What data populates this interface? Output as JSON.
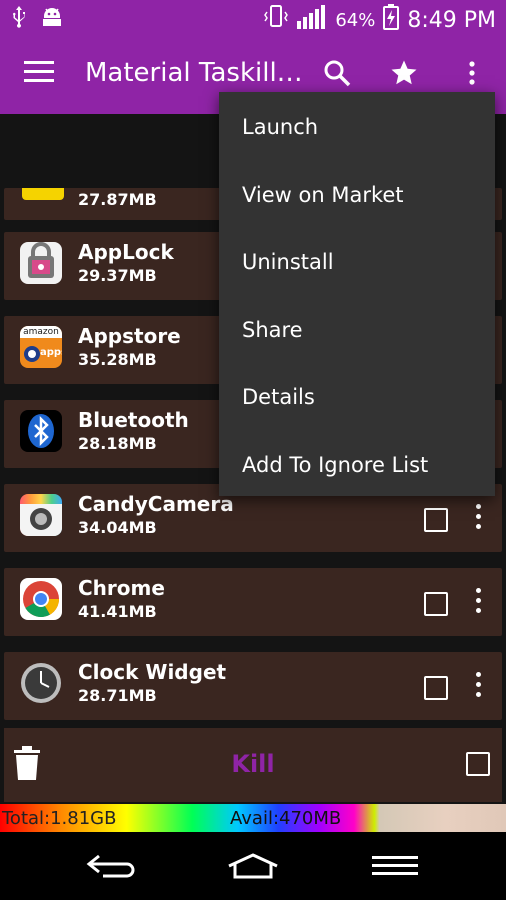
{
  "status_bar": {
    "battery_percent": "64%",
    "time": "8:49 PM"
  },
  "app_bar": {
    "title": "Material Taskill…"
  },
  "apps": [
    {
      "name": "",
      "size": "27.87MB"
    },
    {
      "name": "AppLock",
      "size": "29.37MB"
    },
    {
      "name": "Appstore",
      "size": "35.28MB"
    },
    {
      "name": "Bluetooth",
      "size": "28.18MB"
    },
    {
      "name": "CandyCamera",
      "size": "34.04MB"
    },
    {
      "name": "Chrome",
      "size": "41.41MB"
    },
    {
      "name": "Clock Widget",
      "size": "28.71MB"
    }
  ],
  "appstore_icon_text": {
    "top": "amazon",
    "bottom": "apps"
  },
  "kill_bar": {
    "label": "Kill"
  },
  "memory_bar": {
    "total": "Total:1.81GB",
    "avail": "Avail:470MB"
  },
  "popup_menu": {
    "items": [
      "Launch",
      "View on Market",
      "Uninstall",
      "Share",
      "Details",
      "Add To Ignore List"
    ]
  },
  "colors": {
    "accent": "#8f24a6",
    "card": "#3a2620",
    "popup": "#333333"
  }
}
